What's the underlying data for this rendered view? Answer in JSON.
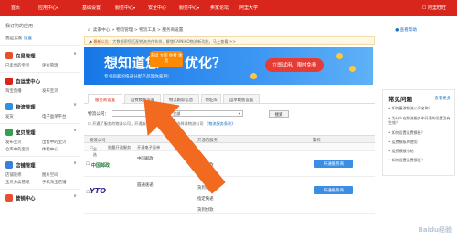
{
  "topnav": {
    "items": [
      "首页",
      "应用中心",
      "基础设置",
      "服务中心",
      "安全中心",
      "服务中心",
      "卖家论坛",
      "阿里大学"
    ],
    "right": "阿里旺旺"
  },
  "sidebar": {
    "title": "我订购的应用",
    "sub_label": "我是卖家",
    "sub_link": "设置",
    "sections": [
      {
        "head": "交易管理",
        "links": [
          "已卖出的宝贝",
          "评价管理"
        ],
        "color": "#e8502d"
      },
      {
        "head": "自运营中心",
        "links": [
          "淘宝直播",
          "发布宝贝"
        ],
        "color": "#d9261c"
      },
      {
        "head": "物流管理",
        "links": [
          "发货",
          "电子面单平台"
        ],
        "color": "#2f8fe0"
      },
      {
        "head": "宝贝管理",
        "links": [
          "发布宝贝",
          "出售中的宝贝",
          "仓库中的宝贝",
          "体检中心"
        ],
        "color": "#33a04f"
      },
      {
        "head": "店铺管理",
        "links": [
          "店铺装修",
          "图片空间",
          "宝贝分类管理",
          "手机淘宝店铺"
        ],
        "color": "#3b7fd6"
      },
      {
        "head": "营销中心",
        "links": [],
        "color": "#e8502d"
      }
    ]
  },
  "breadcrumb": {
    "items": "卖家中心 > 物流管理 > 物流工具 > 服务商设置",
    "help": "查看帮助"
  },
  "notice": {
    "label": "最新公告：",
    "text": "大数据帮您匹配物流合作伙伴，解锁CAINIAO物流新功能，马上查看 >>"
  },
  "banner": {
    "big1": "想知道您",
    "pill": "去试 立即 免费 体验",
    "big2": "优化？",
    "sub": "专业商家的快递分配产品等你来用！",
    "cta": "立即试用，限时免费"
  },
  "tabs": [
    "服务商设置",
    "运费模板设置",
    "物流跟踪信息",
    "地址库",
    "运单模板设置"
  ],
  "filter": {
    "company_label": "物流公司：",
    "company_value": "",
    "region_label": "服务：",
    "region_value": "全部",
    "search": "搜索"
  },
  "hint": {
    "text": "开通了服务的物流公司，开通服务后，在发货时可选择该物流公司",
    "link": "《物流服务条款》"
  },
  "table": {
    "headers": [
      "物流公司",
      "开通的服务",
      "操作"
    ],
    "bar": [
      "全选",
      "批量开通服务",
      "开通电子面单"
    ],
    "rows": [
      {
        "name": "中国邮政",
        "area": "中国邮政",
        "service": "货到付款",
        "btn": "开通服务商"
      },
      {
        "name": "圆通速递",
        "area": "圆通速递",
        "services": [
          "货到付款",
          "指定快递",
          "货到付款"
        ],
        "btn": "开通服务商"
      }
    ]
  },
  "faq": {
    "title": "常见问题",
    "more": "查看更多",
    "items": [
      "如何更改物流公司名称？",
      "为什么在物流服务中开通的设置没有生效？",
      "如何设置运费模板？",
      "运费模板的使用",
      "运费模板小结",
      "如何设置运费模板？"
    ]
  },
  "watermark": "Baidu经验",
  "colors": {
    "brand_red": "#d9261c",
    "blue_button": "#3a8ee6",
    "arrow_orange": "#f26a1f"
  }
}
